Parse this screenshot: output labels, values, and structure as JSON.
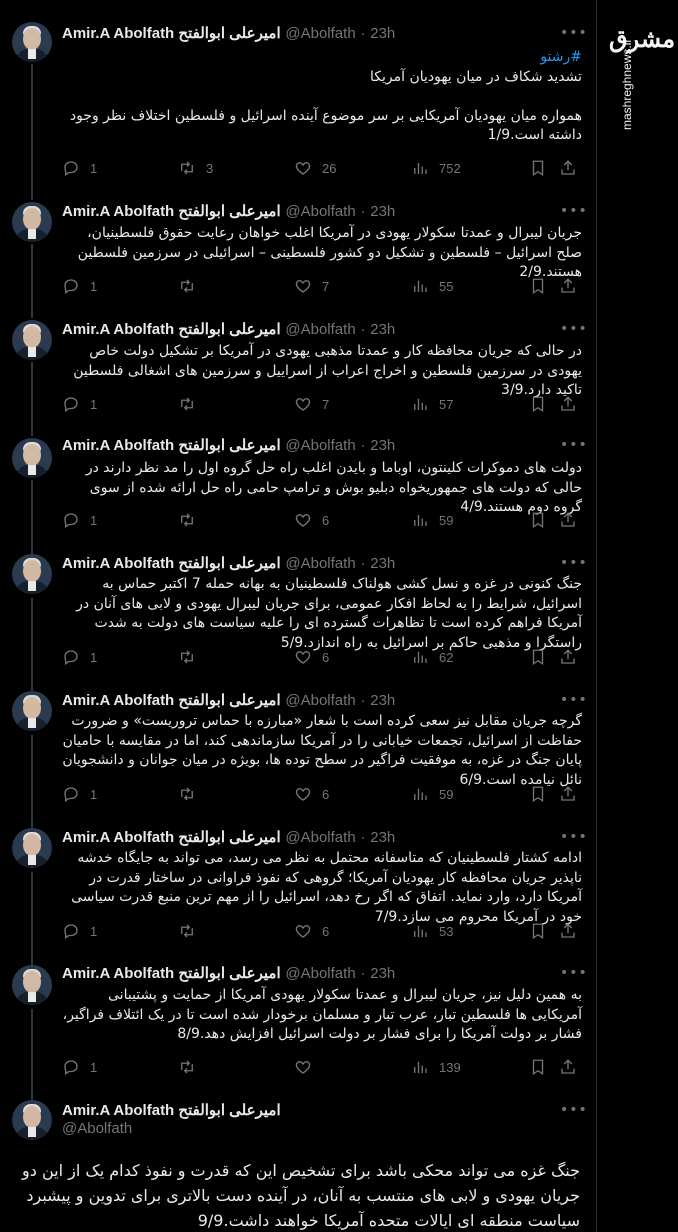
{
  "brand": {
    "logo": "مشرق",
    "url": "mashreghnews.ir"
  },
  "author": {
    "name": "Amir.A Abolfath امیرعلی ابوالفتح",
    "handle": "@Abolfath",
    "dot": "·",
    "time": "23h"
  },
  "tweets": [
    {
      "hashtag": "#رشتو",
      "text": "تشدید شکاف در میان یهودیان آمریکا\n\nهمواره میان یهودیان آمریکایی بر سر موضوع آینده اسرائیل و فلسطین اختلاف نظر وجود داشته است.1/9",
      "replies": "1",
      "retweets": "3",
      "likes": "26",
      "views": "752"
    },
    {
      "text": "جریان لیبرال و عمدتا سکولار یهودی در آمریکا اغلب خواهان رعایت حقوق فلسطینیان، صلح اسرائیل – فلسطین و تشکیل دو کشور فلسطینی – اسرائیلی در سرزمین فلسطین هستند.2/9",
      "replies": "1",
      "retweets": "",
      "likes": "7",
      "views": "55"
    },
    {
      "text": "در حالی که جریان محافظه کار و عمدتا مذهبی یهودی در آمریکا بر تشکیل دولت خاص یهودی در سرزمین فلسطین و اخراج اعراب از اسراییل و سرزمین های اشغالی فلسطین تاکید دارد.3/9",
      "replies": "1",
      "retweets": "",
      "likes": "7",
      "views": "57"
    },
    {
      "text": "دولت های دموکرات کلینتون، اوباما و بایدن اغلب راه حل گروه اول را مد نظر دارند در حالی که دولت های جمهوریخواه دبلیو بوش و ترامپ حامی راه حل ارائه شده از سوی گروه دوم هستند.4/9",
      "replies": "1",
      "retweets": "",
      "likes": "6",
      "views": "59"
    },
    {
      "text": "جنگ کنونی در غزه و نسل کشی هولناک فلسطینیان به بهانه حمله 7 اکتبر حماس به اسرائیل، شرایط را به لحاظ افکار عمومی، برای جریان لیبرال یهودی و لابی های آنان در آمریکا فراهم کرده است تا تظاهرات گسترده ای را علیه سیاست های دولت به شدت راستگرا و مذهبی حاکم بر اسرائیل به راه اندازد.5/9",
      "replies": "1",
      "retweets": "",
      "likes": "6",
      "views": "62"
    },
    {
      "text": "گرچه جریان مقابل نیز سعی کرده است با شعار «مبارزه با حماس تروریست» و ضرورت حفاظت از اسرائیل، تجمعات خیابانی را در آمریکا سازماندهی کند، اما در مقایسه با حامیان پایان جنگ در غزه، به موفقیت فراگیر در سطح توده ها، بویژه در میان جوانان و دانشجویان نائل نیامده است.6/9",
      "replies": "1",
      "retweets": "",
      "likes": "6",
      "views": "59"
    },
    {
      "text": "ادامه کشتار فلسطینیان که متاسفانه محتمل به نظر می رسد، می تواند به جایگاه خدشه ناپذیر جریان محافظه کار یهودیان آمریکا؛ گروهی که نفوذ فراوانی در ساختار قدرت در آمریکا دارد، وارد نماید. اتفاق که اگر رخ دهد، اسرائیل را از مهم ترین منبع قدرت سیاسی خود در آمریکا محروم می سازد.7/9",
      "replies": "1",
      "retweets": "",
      "likes": "6",
      "views": "53"
    },
    {
      "text": "به همین دلیل نیز، جریان لیبرال و عمدتا سکولار یهودی آمریکا از حمایت و پشتیبانی آمریکایی ها فلسطین تبار، عرب تبار و مسلمان برخودار شده است تا در یک ائتلاف فراگیر، فشار بر دولت آمریکا را برای فشار بر دولت اسرائیل افزایش دهد.8/9",
      "replies": "1",
      "retweets": "",
      "likes": "",
      "views": "139"
    }
  ],
  "last_tweet": {
    "text": "جنگ غزه می تواند محکی باشد برای تشخیص این که قدرت و نفوذ کدام یک از این دو جریان یهودی و لابی های منتسب به آنان، در آینده دست بالاتری برای تدوین و پیشبرد سیاست منطقه ای ایالات متحده آمریکا خواهند داشت.9/9"
  },
  "icons": {
    "more": "more-horizontal-icon",
    "reply": "reply-icon",
    "retweet": "retweet-icon",
    "like": "heart-icon",
    "views": "views-chart-icon",
    "bookmark": "bookmark-icon",
    "share": "share-icon"
  },
  "colors": {
    "background": "#000000",
    "text": "#e7e9ea",
    "muted": "#71767b",
    "link": "#1d9bf0"
  }
}
